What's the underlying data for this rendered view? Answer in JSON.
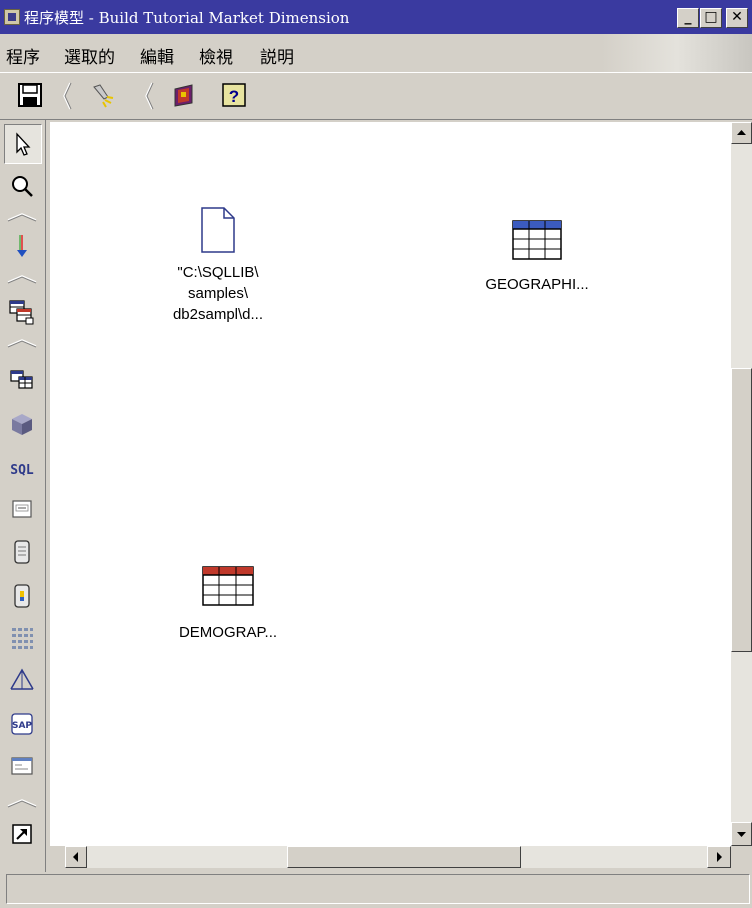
{
  "window": {
    "title": "程序模型 - Build Tutorial Market Dimension",
    "minimize": "_",
    "maximize": "□",
    "close": "✕"
  },
  "menubar": {
    "items": [
      "程序",
      "選取的",
      "編輯",
      "檢視",
      "説明"
    ]
  },
  "toolbar": {
    "icons": [
      "save-icon",
      "flashlight-icon",
      "book-icon",
      "help-icon"
    ],
    "help_label": "?"
  },
  "palette": {
    "icons": [
      "pointer-icon",
      "zoom-icon",
      "data-link-icon",
      "table-copy-icon",
      "source-table-icon",
      "cube-icon",
      "sql-icon",
      "program-icon",
      "file-icon",
      "transformer-icon",
      "grid-icon",
      "statistics-icon",
      "sap-icon",
      "window-icon",
      "shortcut-icon"
    ],
    "sql_label": "SQL",
    "sap_label": "SAP"
  },
  "canvas": {
    "nodes": [
      {
        "type": "file",
        "label_lines": [
          "\"C:\\SQLLIB\\",
          "samples\\",
          "db2sampl\\d..."
        ]
      },
      {
        "type": "table",
        "label_lines": [
          "GEOGRAPHI..."
        ]
      },
      {
        "type": "table",
        "label_lines": [
          "DEMOGRAP..."
        ]
      }
    ]
  },
  "colors": {
    "titlebar": "#3a3aa0",
    "chrome": "#d4d0c8",
    "canvas": "#ffffff",
    "table_header_blue": "#3b5bbf",
    "table_header_red": "#c0392b"
  }
}
